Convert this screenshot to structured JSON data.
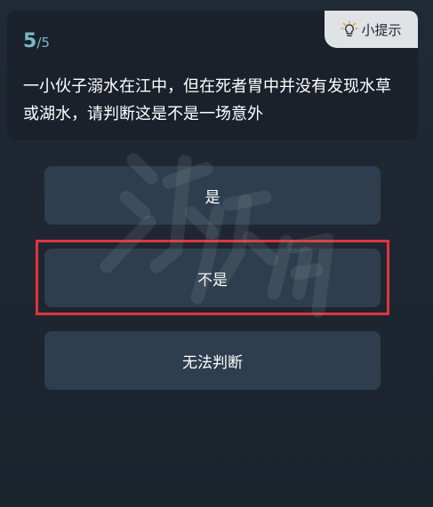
{
  "question": {
    "progress_current": "5",
    "progress_total": "/5",
    "text": "一小伙子溺水在江中，但在死者胃中并没有发现水草或湖水，请判断这是不是一场意外"
  },
  "hint": {
    "icon": "lightbulb-icon",
    "label": "小提示"
  },
  "answers": [
    {
      "label": "是"
    },
    {
      "label": "不是",
      "highlighted": true
    },
    {
      "label": "无法判断"
    }
  ],
  "colors": {
    "background": "#1e2733",
    "card": "#1a212b",
    "answer_button": "#2e3e4e",
    "progress": "#7ab9c6",
    "highlight_border": "#e0353b",
    "hint_button": "#dfe3e6"
  }
}
